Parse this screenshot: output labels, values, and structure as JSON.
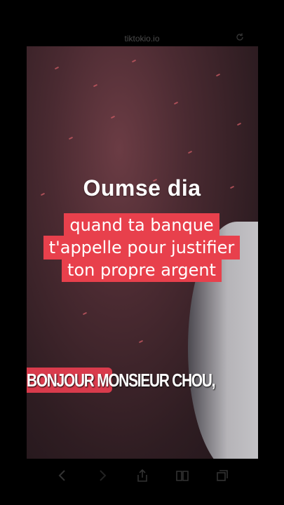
{
  "browser": {
    "url": "tiktokio.io"
  },
  "video": {
    "title": "Oumse dia",
    "caption_lines": [
      "quand ta banque",
      "t'appelle pour justifier",
      "ton propre argent"
    ],
    "subtitle": "BONJOUR MONSIEUR CHOU,"
  },
  "toolbar": {
    "icons": [
      "back-icon",
      "forward-icon",
      "share-icon",
      "bookmarks-icon",
      "tabs-icon"
    ]
  },
  "colors": {
    "caption_bg": "#e8404c",
    "subtitle_highlight": "#d93b4c"
  }
}
